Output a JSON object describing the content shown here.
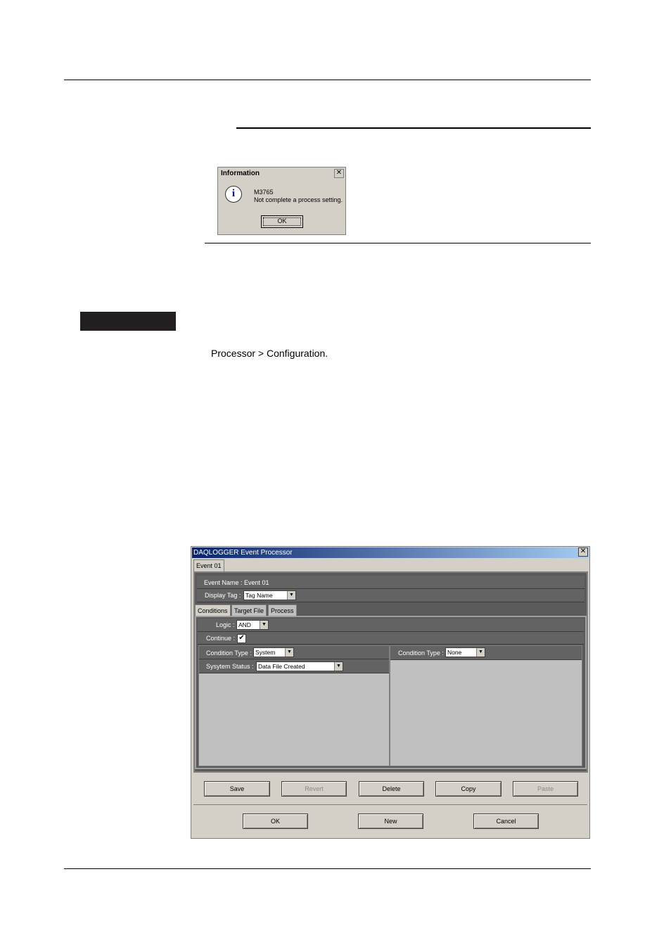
{
  "info_dialog": {
    "title": "Information",
    "close_glyph": "✕",
    "icon": "information-icon",
    "code": "M3765",
    "message": "Not complete a process setting.",
    "ok_label": "OK"
  },
  "body_text": "Processor > Configuration.",
  "window": {
    "title": "DAQLOGGER Event Processor",
    "close_glyph": "✕",
    "event_tab": "Event 01",
    "event_name_label": "Event Name :",
    "event_name_value": "Event 01",
    "display_tag_label": "Display Tag :",
    "display_tag_value": "Tag Name",
    "tabs": [
      "Conditions",
      "Target File",
      "Process"
    ],
    "logic_label": "Logic :",
    "logic_value": "AND",
    "continue_label": "Continue :",
    "continue_checked": "✔",
    "left": {
      "condition_type_label": "Condition Type :",
      "condition_type_value": "System",
      "system_status_label": "Sysytem Status :",
      "system_status_value": "Data File Created"
    },
    "right": {
      "condition_type_label": "Condition Type :",
      "condition_type_value": "None"
    },
    "buttons_row1": [
      "Save",
      "Revert",
      "Delete",
      "Copy",
      "Paste"
    ],
    "buttons_row2": [
      "OK",
      "New",
      "Cancel"
    ],
    "dropdown_glyph": "▼"
  }
}
